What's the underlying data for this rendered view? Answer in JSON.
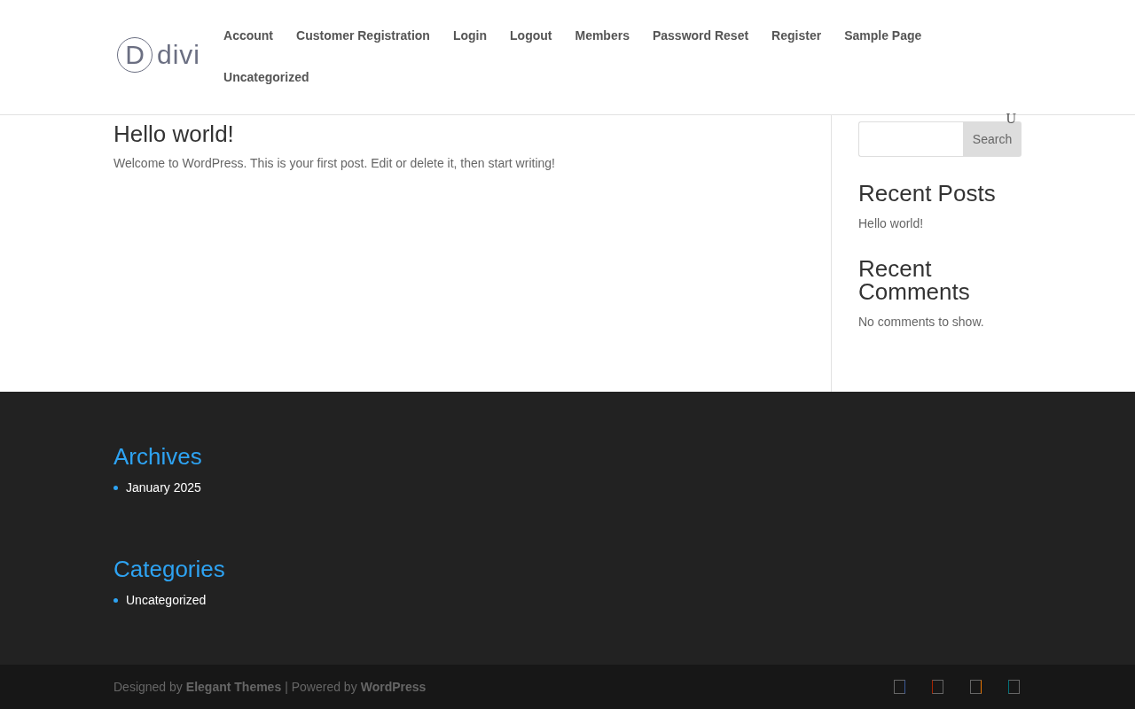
{
  "header": {
    "logo_text": "divi",
    "logo_letter": "D",
    "nav": [
      {
        "label": "Account"
      },
      {
        "label": "Customer Registration"
      },
      {
        "label": "Login"
      },
      {
        "label": "Logout"
      },
      {
        "label": "Members"
      },
      {
        "label": "Password Reset"
      },
      {
        "label": "Register"
      },
      {
        "label": "Sample Page"
      },
      {
        "label": "Uncategorized"
      }
    ]
  },
  "post": {
    "title": "Hello world!",
    "excerpt": "Welcome to WordPress. This is your first post. Edit or delete it, then start writing!"
  },
  "sidebar": {
    "stray_glyph": "U",
    "search_button": "Search",
    "widgets": [
      {
        "title": "Recent Posts",
        "items": [
          "Hello world!"
        ]
      },
      {
        "title": "Recent Comments",
        "items": [
          "No comments to show."
        ]
      }
    ]
  },
  "footer": {
    "widgets": [
      {
        "title": "Archives",
        "items": [
          "January 2025"
        ]
      },
      {
        "title": "Categories",
        "items": [
          "Uncategorized"
        ]
      }
    ]
  },
  "bottom_bar": {
    "credits": [
      {
        "text": "Designed by",
        "kind": "text"
      },
      {
        "text": "Elegant Themes",
        "kind": "link"
      },
      {
        "text": "| Powered by",
        "kind": "text"
      },
      {
        "text": "WordPress",
        "kind": "link"
      }
    ],
    "social": [
      {
        "color": "#3b5998"
      },
      {
        "color": "#a82400"
      },
      {
        "color": "#ea7500"
      },
      {
        "color": "#00707a"
      }
    ]
  }
}
